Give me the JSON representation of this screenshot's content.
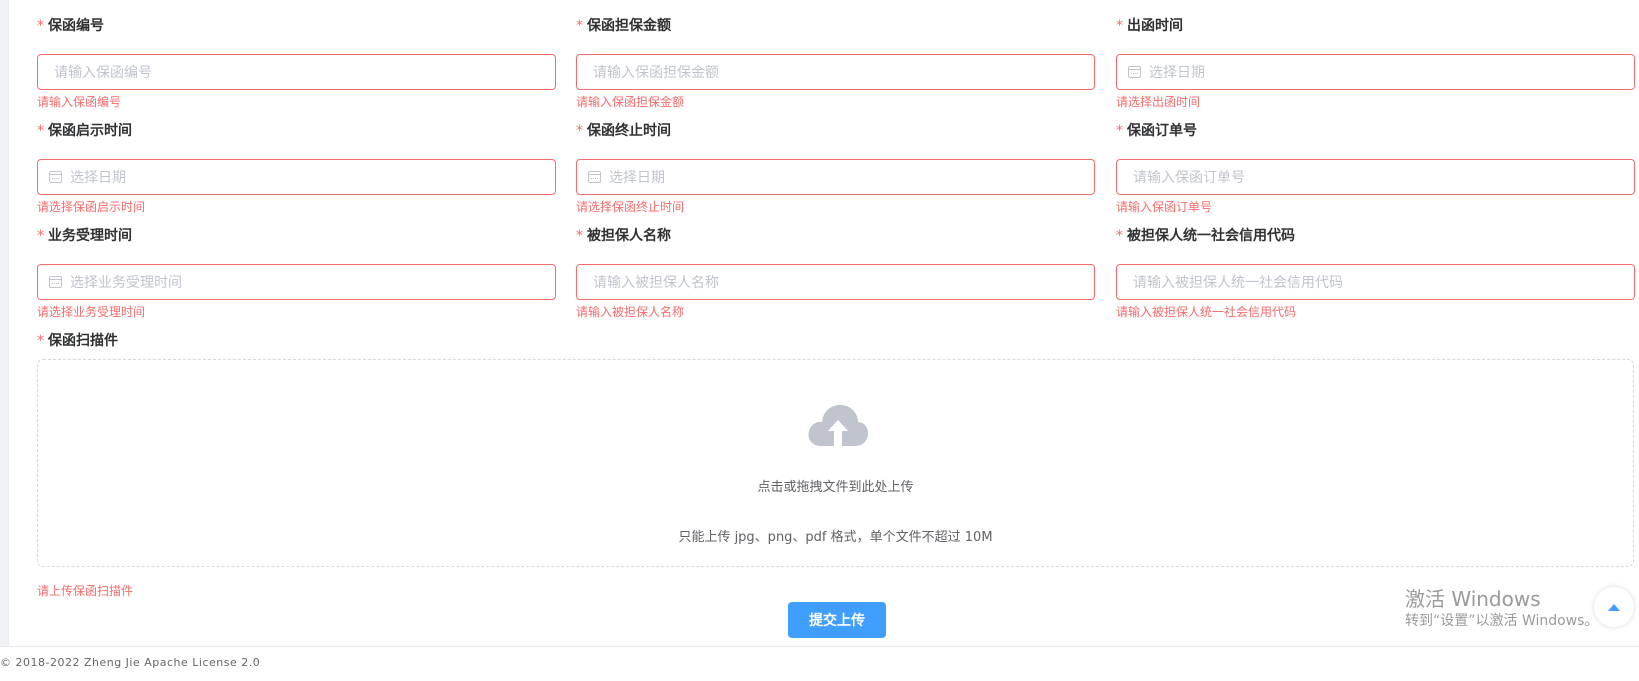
{
  "fields": [
    {
      "label": "保函编号",
      "placeholder": "请输入保函编号",
      "error": "请输入保函编号",
      "date": false
    },
    {
      "label": "保函担保金额",
      "placeholder": "请输入保函担保金额",
      "error": "请输入保函担保金额",
      "date": false
    },
    {
      "label": "出函时间",
      "placeholder": "选择日期",
      "error": "请选择出函时间",
      "date": true
    },
    {
      "label": "保函启示时间",
      "placeholder": "选择日期",
      "error": "请选择保函启示时间",
      "date": true
    },
    {
      "label": "保函终止时间",
      "placeholder": "选择日期",
      "error": "请选择保函终止时间",
      "date": true
    },
    {
      "label": "保函订单号",
      "placeholder": "请输入保函订单号",
      "error": "请输入保函订单号",
      "date": false
    },
    {
      "label": "业务受理时间",
      "placeholder": "选择业务受理时间",
      "error": "请选择业务受理时间",
      "date": true
    },
    {
      "label": "被担保人名称",
      "placeholder": "请输入被担保人名称",
      "error": "请输入被担保人名称",
      "date": false
    },
    {
      "label": "被担保人统一社会信用代码",
      "placeholder": "请输入被担保人统一社会信用代码",
      "error": "请输入被担保人统一社会信用代码",
      "date": false
    }
  ],
  "required_mark": "*",
  "upload": {
    "label": "保函扫描件",
    "drop_text": "点击或拖拽文件到此处上传",
    "hint": "只能上传 jpg、png、pdf 格式，单个文件不超过 10M",
    "error": "请上传保函扫描件"
  },
  "submit_label": "提交上传",
  "watermark": {
    "line1": "激活 Windows",
    "line2": "转到“设置”以激活 Windows。"
  },
  "footer": "© 2018-2022 Zheng Jie Apache License 2.0",
  "colors": {
    "error": "#f56c6c",
    "primary": "#409eff",
    "icon": "#c0c4cc"
  }
}
